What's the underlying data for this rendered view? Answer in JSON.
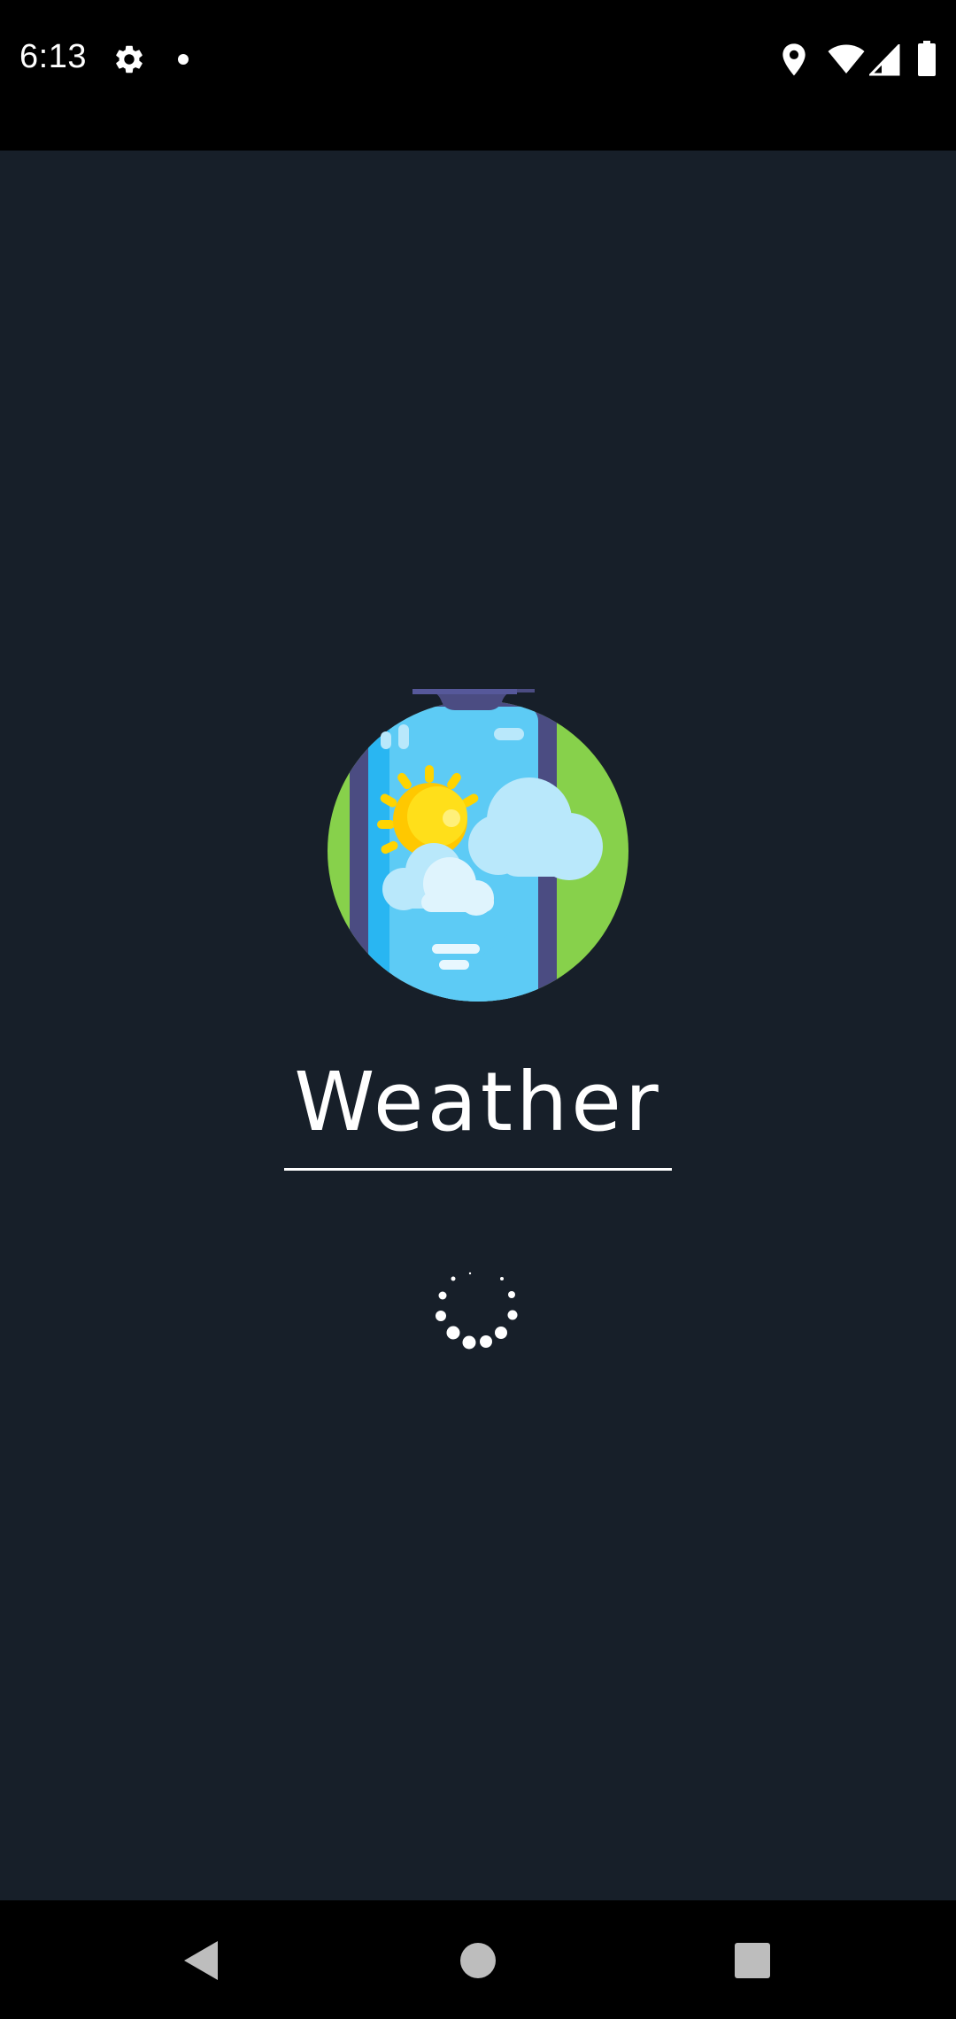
{
  "status_bar": {
    "time": "6:13",
    "icons": [
      "settings-icon",
      "notification-dot-icon",
      "location-icon",
      "wifi-icon",
      "cellular-signal-icon",
      "battery-icon"
    ]
  },
  "splash": {
    "app_title": "Weather",
    "logo_icon": "phone-weather-icon",
    "loading_indicator": "loading-spinner"
  },
  "nav_bar": {
    "buttons": [
      "back-icon",
      "home-icon",
      "recents-icon"
    ]
  },
  "colors": {
    "background": "#171f29",
    "bars": "#000000",
    "title": "#ffffff",
    "logo_circle": "#87d14b",
    "phone_frame": "#4a4a7e",
    "phone_screen": "#5dc8f3",
    "sun": "#ffd400",
    "cloud": "#b9e8fb"
  }
}
